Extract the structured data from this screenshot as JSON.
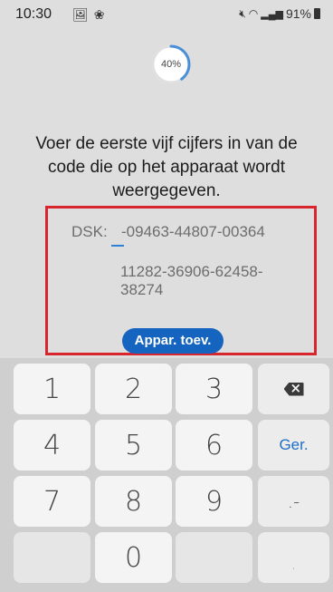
{
  "status_bar": {
    "time": "10:30",
    "battery": "91%",
    "icons": [
      "image-icon",
      "fan-icon",
      "mute-icon",
      "wifi-icon",
      "signal-icon",
      "battery-icon"
    ]
  },
  "progress": {
    "value": 0.4,
    "label": "40%",
    "color": "#4a90d9"
  },
  "instruction": "Voer de eerste vijf cijfers in van de code die op het apparaat wordt weergegeven.",
  "dsk": {
    "label": "DSK:",
    "input_value": "",
    "first_line_suffix": "-09463-44807-00364",
    "rest": "11282-36906-62458-38274",
    "highlight_color": "#d7262e"
  },
  "add_button": {
    "label": "Appar. toev.",
    "color": "#1565c0"
  },
  "keypad": {
    "keys": [
      "1",
      "2",
      "3",
      "4",
      "5",
      "6",
      "7",
      "8",
      "9",
      "0"
    ],
    "go_label": "Ger.",
    "dash_label": ".-",
    "comma_label": ","
  }
}
